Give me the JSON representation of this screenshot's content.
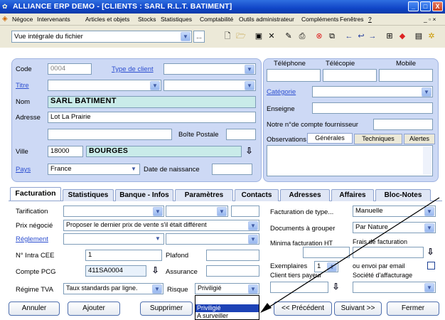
{
  "window": {
    "title": "ALLIANCE ERP DEMO - [CLIENTS : SARL R.L.T. BATIMENT]",
    "minimize": "_",
    "maximize": "□",
    "close": "X"
  },
  "menu": [
    "Négoce",
    "Intervenants",
    "Articles et objets",
    "Stocks",
    "Statistiques",
    "Comptabilité",
    "Outils administrateur",
    "Compléments",
    "Fenêtres",
    "?"
  ],
  "menu_right": "_ ▫ ×",
  "toolbar": {
    "view_select": "Vue intégrale du fichier",
    "dots_button": "..."
  },
  "client": {
    "code_label": "Code",
    "code_value": "0004",
    "type_label": "Type de client",
    "titre_label": "Titre",
    "nom_label": "Nom",
    "nom_value": "SARL BATIMENT",
    "adresse_label": "Adresse",
    "adresse_value": "Lot La Prairie",
    "bp_label": "Boîte Postale",
    "ville_label": "Ville",
    "cp_value": "18000",
    "ville_value": "BOURGES",
    "pays_label": "Pays",
    "pays_value": "France",
    "naissance_label": "Date de naissance"
  },
  "contact": {
    "telephone_label": "Téléphone",
    "telecopie_label": "Télécopie",
    "mobile_label": "Mobile",
    "categorie_label": "Catégorie",
    "enseigne_label": "Enseigne",
    "fournisseur_label": "Notre n°de compte fournisseur",
    "observations_label": "Observations",
    "obs_tabs": [
      "Générales",
      "Techniques",
      "Alertes"
    ]
  },
  "tabs": [
    "Facturation",
    "Statistiques",
    "Banque - Infos",
    "Paramètres",
    "Contacts",
    "Adresses",
    "Affaires",
    "Bloc-Notes"
  ],
  "facturation": {
    "tarification_label": "Tarification",
    "prix_label": "Prix négocié",
    "prix_value": "Proposer le dernier prix de vente s'il était différent",
    "reglement_label": "Réglement",
    "cee_label": "N° Intra CEE",
    "cee_value": "1",
    "plafond_label": "Plafond",
    "pcg_label": "Compte PCG",
    "pcg_value": "411SA0004",
    "assurance_label": "Assurance",
    "tva_label": "Régime TVA",
    "tva_value": "Taux standards par ligne.",
    "risque_label": "Risque",
    "risque_value": "Priviligié",
    "risque_options": [
      "Priviligié",
      "A surveiller"
    ],
    "type_label": "Facturation de type...",
    "type_value": "Manuelle",
    "docs_label": "Documents à grouper",
    "docs_value": "Par Nature",
    "minima_label": "Minima facturation HT",
    "frais_label": "Frais de facturation",
    "exemplaires_label": "Exemplaires",
    "exemplaires_value": "1",
    "email_label": "ou envoi par email",
    "payeur_label": "Client tiers payeur",
    "affacturage_label": "Société d'affacturage"
  },
  "buttons": {
    "annuler": "Annuler",
    "ajouter": "Ajouter",
    "supprimer": "Supprimer",
    "precedent": "<< Précédent",
    "suivant": "Suivant >>",
    "fermer": "Fermer"
  }
}
